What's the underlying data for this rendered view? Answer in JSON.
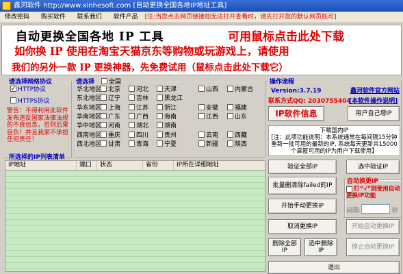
{
  "window": {
    "title": "鑫河软件 http://www.xinhesoft.com [自动更换全国各地IP地址工具]"
  },
  "menu": {
    "items": [
      "修改密码",
      "购买软件",
      "联系我们",
      "软件产品"
    ],
    "notice": "[注:当您点击网页链接如无法打开查看时，请先打开您的默认网页既可]"
  },
  "banner": {
    "line1a": "自动更换全国各地 IP 工具",
    "line1b": "可用鼠标点击此处下载",
    "line2": "如你换 IP 使用在淘宝天猫京东等购物或玩游戏上，请使用",
    "line3": "我们的另外一款 IP 更换神器，先免费试用（鼠标点击此处下载它）"
  },
  "protocol": {
    "title": "请选择网络协议",
    "options": [
      {
        "label": "HTTP协议",
        "checked": true
      },
      {
        "label": "HTTPS协议",
        "checked": false
      }
    ],
    "warning": "警告：不得利用此软件发布违反国家法律法规的不良信息，否则后果自负！并且我家不承担任何责任！"
  },
  "region": {
    "title": "请选择",
    "all_label": "全国",
    "areas": [
      {
        "name": "华北地区:",
        "provinces": [
          "北京",
          "河北",
          "天津",
          "山西",
          "内蒙古"
        ]
      },
      {
        "name": "东北地区:",
        "provinces": [
          "辽宁",
          "吉林",
          "黑龙江"
        ]
      },
      {
        "name": "华东地区:",
        "provinces": [
          "上海",
          "江苏",
          "浙江",
          "安徽",
          "福建"
        ]
      },
      {
        "name": "华南地区:",
        "provinces": [
          "广东",
          "广西",
          "海南",
          "江西",
          "山东"
        ]
      },
      {
        "name": "华中地区:",
        "provinces": [
          "河南",
          "湖北",
          "湖南"
        ]
      },
      {
        "name": "西南地区:",
        "provinces": [
          "重庆",
          "四川",
          "贵州",
          "云南",
          "西藏"
        ]
      },
      {
        "name": "西北地区:",
        "provinces": [
          "甘肃",
          "青海",
          "宁夏",
          "新疆",
          "陕西"
        ]
      }
    ]
  },
  "ip_list": {
    "title": "所选择的IP列表清单",
    "columns": [
      "IP地址",
      "端口",
      "状态",
      "省份",
      "IP所在详细地址"
    ]
  },
  "operation": {
    "title": "操作流程",
    "version": "Version:3.7.19",
    "qq": "联系方式QQ: 2030755404",
    "official_site": "鑫河软件官方网站",
    "manual": "[本软件操作说明]",
    "ip_info_button": "IP软件信息",
    "user_add_ip_button": "用户自己增IP",
    "info_lines": [
      "下载国内IP",
      "[注：此项功能说明：本系统通常在每间隔15分钟重新一批可用的最新的IP, 系统每天更新共15000个高匿可用的IP为用户下载使用】"
    ],
    "verify_all": "验证全部IP",
    "verify_selected": "选中验证IP",
    "batch_delete_failed": "批量删清除failed的IP",
    "auto_change_title": "自动换更IP",
    "auto_change_hint": "打“√”则使用自动更换IP功能",
    "interval_label": "间隔:",
    "interval_unit": "秒",
    "start_manual": "开始手动更换IP",
    "cancel_change": "取消更换IP",
    "start_auto": "开始自动更换IP",
    "delete_all": "删除全部IP",
    "delete_selected": "选中删除IP",
    "stop_auto": "停止自动更换IP",
    "exit": "退出"
  },
  "colors": {
    "title_bar": "#1c4fb8",
    "accent_red": "#e00000",
    "accent_blue": "#0000c0",
    "list_bg": "#b7dfb2"
  }
}
